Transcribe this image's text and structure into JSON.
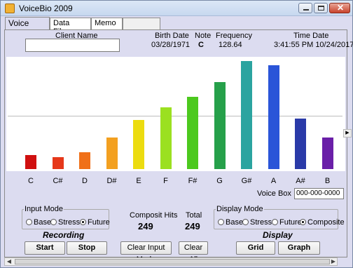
{
  "window": {
    "title": "VoiceBio 2009"
  },
  "tabs": [
    {
      "label": "Voice Input",
      "active": true
    },
    {
      "label": "Data Files",
      "active": false
    },
    {
      "label": "Memo",
      "active": false
    }
  ],
  "header": {
    "client_name_label": "Client Name",
    "client_name_value": "",
    "birth_date_label": "Birth Date",
    "birth_date_value": "03/28/1971",
    "note_label": "Note",
    "note_value": "C",
    "frequency_label": "Frequency",
    "frequency_value": "128.64",
    "time_date_label": "Time Date",
    "time_date_value": "3:41:55 PM  10/24/2017"
  },
  "chart_data": {
    "type": "bar",
    "categories": [
      "C",
      "C#",
      "D",
      "D#",
      "E",
      "F",
      "F#",
      "G",
      "G#",
      "A",
      "A#",
      "B"
    ],
    "values": [
      14,
      12,
      17,
      31,
      49,
      61,
      72,
      86,
      107,
      103,
      50,
      31
    ],
    "ylim": [
      0,
      110
    ],
    "midline": 55,
    "colors": [
      "#d01010",
      "#e6381a",
      "#f07018",
      "#f3a020",
      "#ecdc10",
      "#9be020",
      "#4cc91e",
      "#26a04a",
      "#2ba4a0",
      "#2a55d8",
      "#2a3aa8",
      "#6a1fa8",
      "#7a2fb0"
    ]
  },
  "voice_box": {
    "label": "Voice Box ID",
    "value": "000-000-0000"
  },
  "input_mode": {
    "label": "Input Mode",
    "options": [
      "Base",
      "Stress",
      "Future"
    ],
    "selected": "Future"
  },
  "display_mode": {
    "label": "Display Mode",
    "options": [
      "Base",
      "Stress",
      "Future",
      "Composite"
    ],
    "selected": "Composite"
  },
  "stats": {
    "composit_hits_label": "Composit Hits",
    "composit_hits_value": "249",
    "total_label": "Total",
    "total_value": "249"
  },
  "recording": {
    "title": "Recording",
    "start_label": "Start",
    "stop_label": "Stop"
  },
  "actions": {
    "clear_input_mode_label": "Clear Input Mode",
    "clear_all_label": "Clear All"
  },
  "display": {
    "title": "Display",
    "grid_label": "Grid",
    "graph_label": "Graph"
  }
}
